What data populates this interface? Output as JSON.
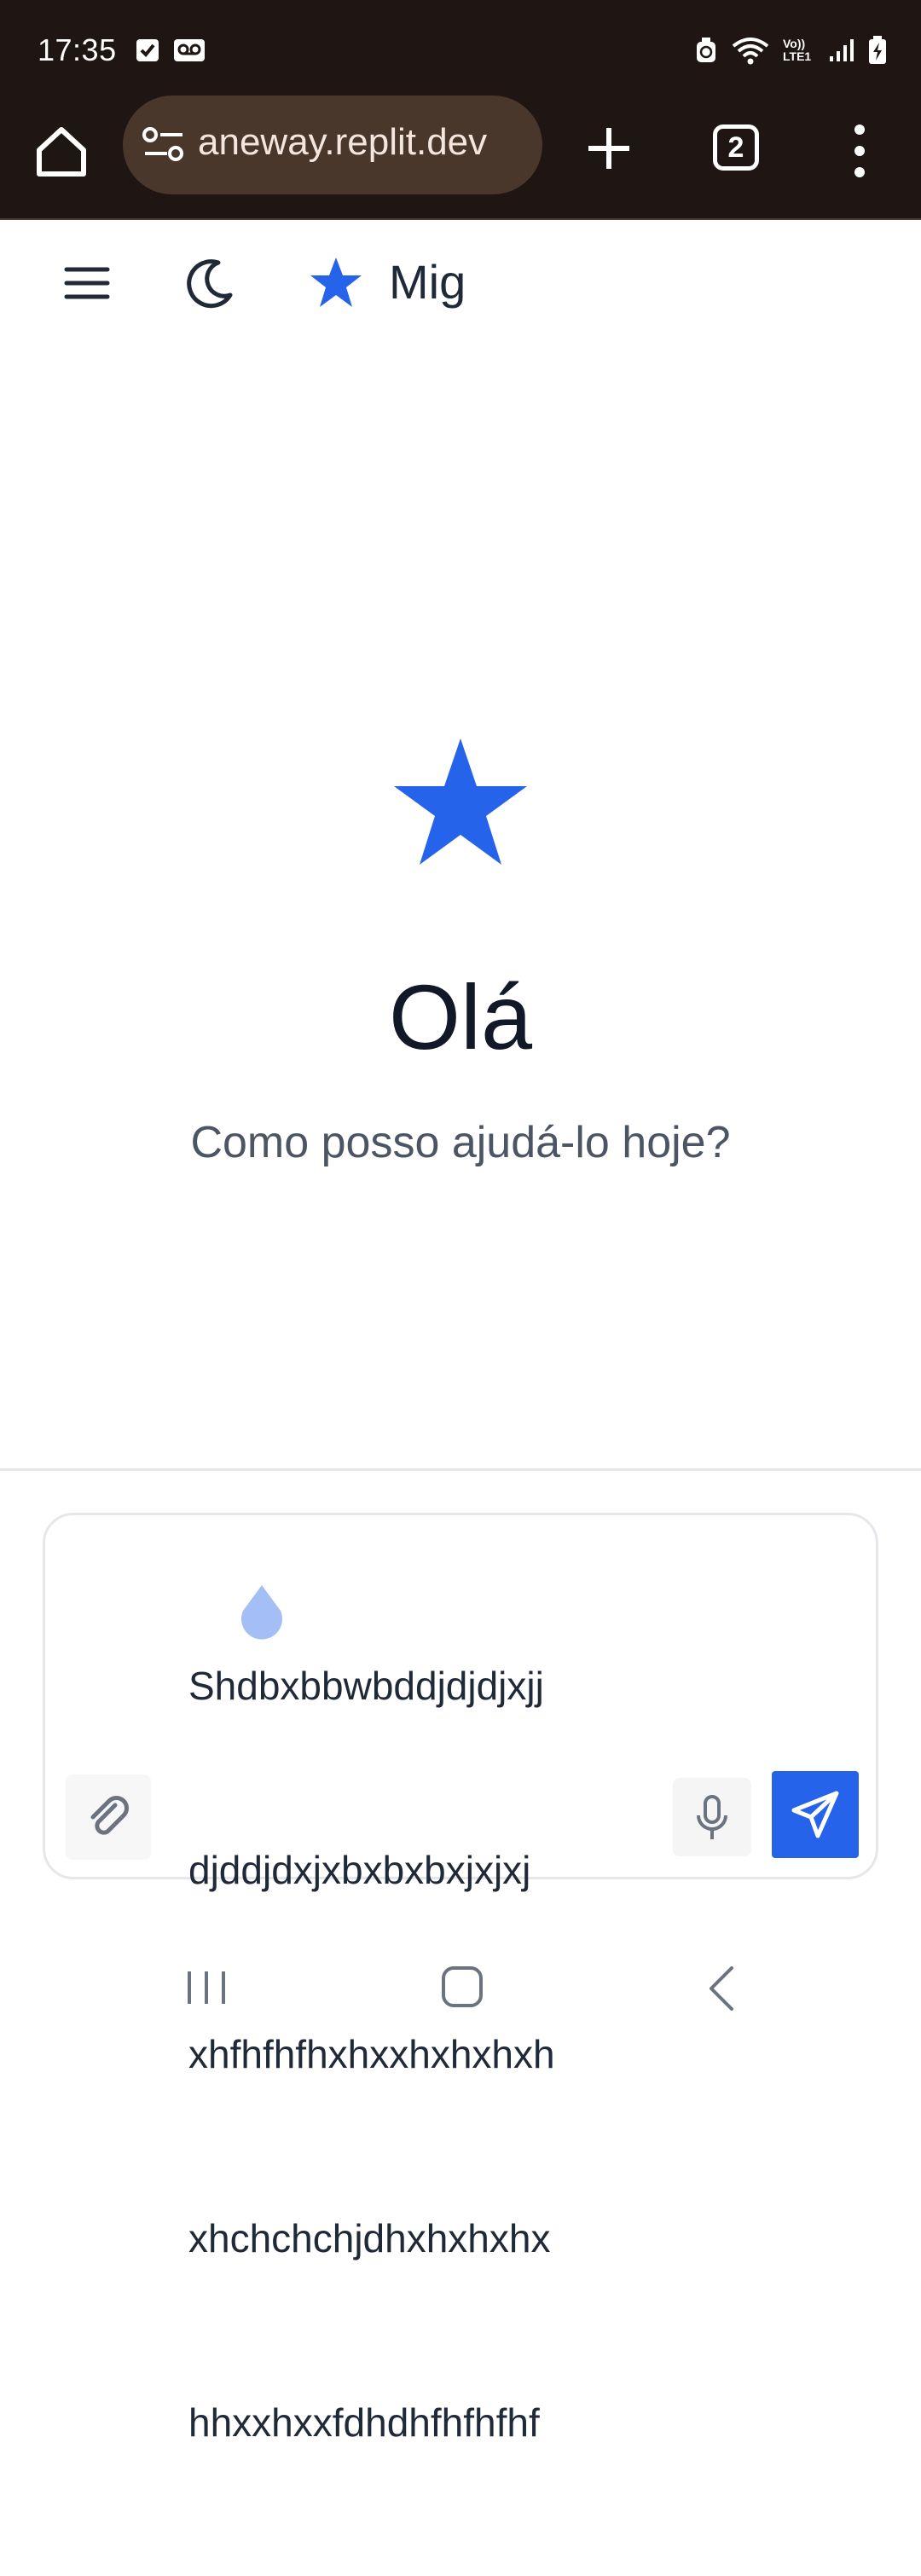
{
  "status_bar": {
    "time": "17:35",
    "left_icons": [
      "checkbox-notification-icon",
      "voicemail-icon"
    ],
    "right_icons": [
      "alarm-icon",
      "wifi-icon",
      "volte-icon",
      "signal-icon",
      "battery-charging-icon"
    ],
    "volte_label": "Vo)) LTE1"
  },
  "browser": {
    "url": "aneway.replit.dev",
    "tab_count": "2",
    "icons": [
      "home-icon",
      "site-settings-icon",
      "plus-icon",
      "more-vert-icon"
    ]
  },
  "app_header": {
    "brand_name": "Mig",
    "icons": [
      "hamburger-menu-icon",
      "moon-icon",
      "star-icon"
    ]
  },
  "hero": {
    "title": "Olá",
    "subtitle": "Como posso ajudá-lo hoje?"
  },
  "composer": {
    "text": "Shdbxbbwbddjdjdjxjj djddjdxjxbxbxbxjxjxj xhfhfhfhxhxxhxhxhxh xhchchchjdhxhxhxhx hhxxhxxfdhdhfhfhfhf",
    "lines": [
      "Shdbxbbwbddjdjdjxjj",
      "djddjdxjxbxbxbxjxjxj",
      "xhfhfhfhxhxxhxhxhxh",
      "xhchchchjdhxhxhxhx",
      "hhxxhxxfdhdhfhfhfhf"
    ]
  },
  "colors": {
    "accent": "#2563eb",
    "status_bar_bg": "#1f1512",
    "url_pill_bg": "#4a372c",
    "text_primary": "#111827",
    "text_secondary": "#4b5563"
  }
}
